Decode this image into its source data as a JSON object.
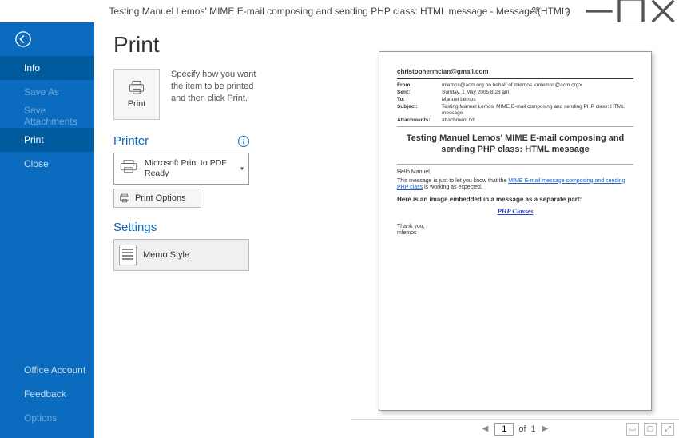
{
  "titlebar": {
    "title": "Testing Manuel Lemos' MIME E-mail composing and sending PHP class: HTML message  -  Message (HTML)"
  },
  "sidebar": {
    "items": [
      {
        "label": "Info",
        "active": true
      },
      {
        "label": "Save As",
        "disabled": true
      },
      {
        "label": "Save Attachments",
        "disabled": true
      },
      {
        "label": "Print",
        "active": true
      },
      {
        "label": "Close"
      }
    ],
    "bottom": [
      {
        "label": "Office Account"
      },
      {
        "label": "Feedback"
      },
      {
        "label": "Options",
        "disabled": true
      }
    ]
  },
  "page": {
    "title": "Print",
    "print_tile_label": "Print",
    "instructions": "Specify how you want the item to be printed and then click Print."
  },
  "printer_section": {
    "header": "Printer",
    "selected_name": "Microsoft Print to PDF",
    "selected_status": "Ready",
    "options_label": "Print Options"
  },
  "settings_section": {
    "header": "Settings",
    "style_label": "Memo Style"
  },
  "preview": {
    "recipient": "christophermcian@gmail.com",
    "headers": {
      "from_label": "From:",
      "from_value": "mlemos@acm.org on behalf of mlemos <mlemos@acm.org>",
      "sent_label": "Sent:",
      "sent_value": "Sunday, 1 May 2005 8:28 am",
      "to_label": "To:",
      "to_value": "Manuel Lemos",
      "subject_label": "Subject:",
      "subject_value": "Testing Manuel Lemos' MIME E-mail composing and sending PHP class: HTML message",
      "attachments_label": "Attachments:",
      "attachments_value": "attachment.txt"
    },
    "message_title": "Testing Manuel Lemos' MIME E-mail composing and sending PHP class: HTML message",
    "greeting": "Hello Manuel,",
    "body_before_link": "This message is just to let you know that the ",
    "body_link_text": "MIME E-mail message composing and sending PHP class",
    "body_after_link": " is working as expected.",
    "embed_heading": "Here is an image embedded in a message as a separate part:",
    "php_classes": "PHP Classes",
    "thankyou": "Thank you,",
    "signer": "mlemos"
  },
  "pager": {
    "current": "1",
    "of_label": "of",
    "total": "1"
  }
}
